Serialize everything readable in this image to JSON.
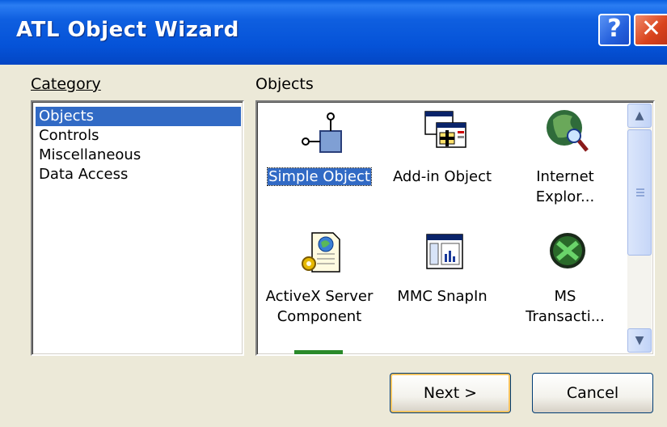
{
  "window": {
    "title": "ATL Object Wizard",
    "help_glyph": "?",
    "close_glyph": "✕"
  },
  "category": {
    "label": "Category",
    "items": [
      {
        "label": "Objects",
        "selected": true
      },
      {
        "label": "Controls",
        "selected": false
      },
      {
        "label": "Miscellaneous",
        "selected": false
      },
      {
        "label": "Data Access",
        "selected": false
      }
    ]
  },
  "objects": {
    "label": "Objects",
    "items": [
      {
        "label": "Simple Object",
        "icon": "simple-object-icon",
        "selected": true
      },
      {
        "label": "Add-in Object",
        "icon": "add-in-object-icon",
        "selected": false
      },
      {
        "label": "Internet\nExplor...",
        "icon": "internet-explorer-icon",
        "selected": false
      },
      {
        "label": "ActiveX Server\nComponent",
        "icon": "activex-server-component-icon",
        "selected": false
      },
      {
        "label": "MMC SnapIn",
        "icon": "mmc-snapin-icon",
        "selected": false
      },
      {
        "label": "MS\nTransacti...",
        "icon": "ms-transaction-icon",
        "selected": false
      }
    ],
    "scroll": {
      "up_glyph": "▲",
      "down_glyph": "▼"
    }
  },
  "buttons": {
    "next": "Next >",
    "cancel": "Cancel"
  },
  "colors": {
    "titlebar": "#0553d8",
    "selection": "#316ac5",
    "face": "#ece9d8"
  }
}
